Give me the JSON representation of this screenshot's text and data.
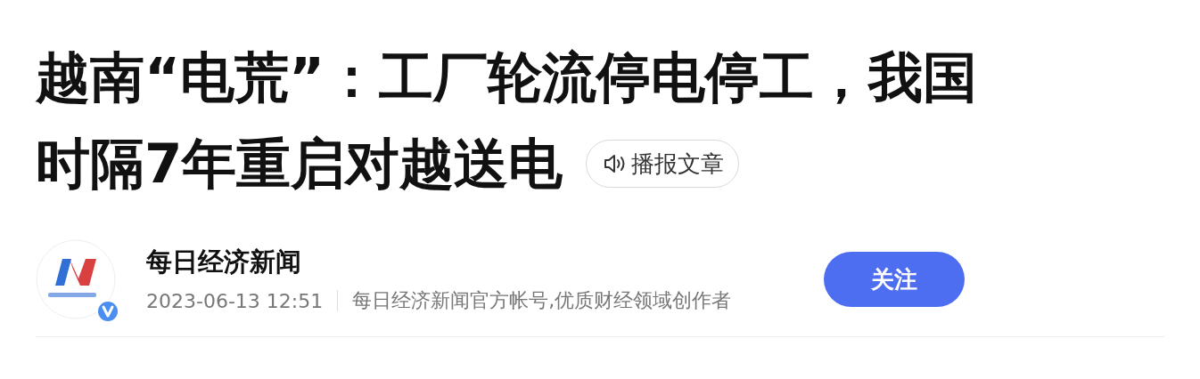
{
  "article": {
    "title_lines": [
      "越南“电荒”：工厂轮流停电停工，我国",
      "时隔7年重启对越送电"
    ],
    "read_aloud_button": "播报文章"
  },
  "author": {
    "name": "每日经济新闻",
    "verified": true,
    "date": "2023-06-13 12:51",
    "description": "每日经济新闻官方帐号,优质财经领域创作者",
    "follow_button": "关注"
  }
}
